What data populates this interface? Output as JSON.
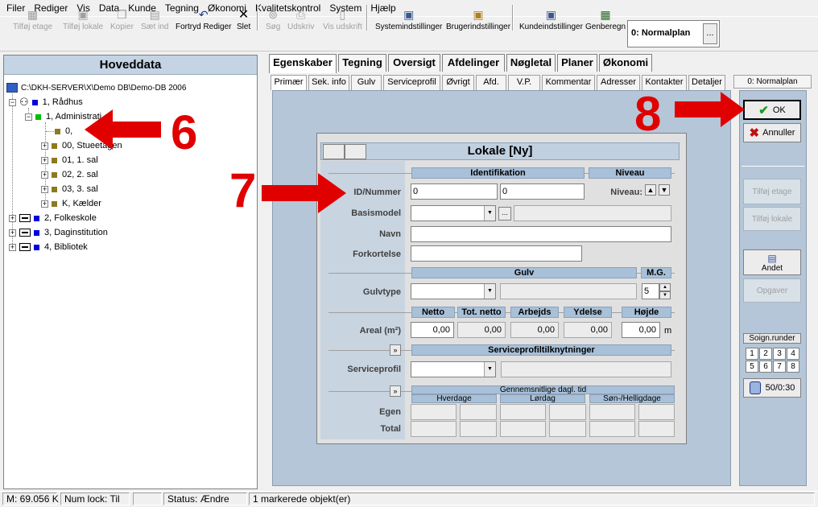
{
  "menu": [
    "Filer",
    "Rediger",
    "Vis",
    "Data",
    "Kunde",
    "Tegning",
    "Økonomi",
    "Kvalitetskontrol",
    "System",
    "Hjælp"
  ],
  "toolbar": {
    "tilfoj_etage": "Tilføj etage",
    "tilfoj_lokale": "Tilføj lokale",
    "kopier": "Kopier",
    "saet_ind": "Sæt ind",
    "fortryd": "Fortryd Rediger",
    "slet": "Slet",
    "sog": "Søg",
    "udskriv": "Udskriv",
    "vis_udskrift": "Vis udskrift",
    "systemindstillinger": "Systemindstillinger",
    "brugerindstillinger": "Brugerindstillinger",
    "kundeindstillinger": "Kundeindstillinger",
    "genberegn": "Genberegn",
    "plan": "0: Normalplan",
    "plan_btn": "..."
  },
  "left": {
    "title": "Hoveddata",
    "root": "C:\\DKH-SERVER\\X\\Demo DB\\Demo-DB 2006",
    "nodes": [
      "1, Rådhus",
      "1, Administrati",
      "0,",
      "00, Stueetagen",
      "01, 1. sal",
      "02, 2. sal",
      "03, 3. sal",
      "K, Kælder",
      "2, Folkeskole",
      "3, Daginstitution",
      "4, Bibliotek"
    ]
  },
  "tabs": [
    "Egenskaber",
    "Tegning",
    "Oversigt",
    "Afdelinger",
    "Nøgletal",
    "Planer",
    "Økonomi"
  ],
  "subtabs": [
    "Primær",
    "Sek. info",
    "Gulv",
    "Serviceprofil",
    "Øvrigt",
    "Afd.",
    "V.P.",
    "Kommentar",
    "Adresser",
    "Kontakter",
    "Detaljer"
  ],
  "dialog": {
    "title": "Lokale [Ny]",
    "identifikation": "Identifikation",
    "niveau_hdr": "Niveau",
    "id_label": "ID/Nummer",
    "id_val1": "0",
    "id_val2": "0",
    "niveau_label": "Niveau:",
    "basismodel": "Basismodel",
    "basis_btn": "...",
    "navn": "Navn",
    "forkortelse": "Forkortelse",
    "gulv_hdr": "Gulv",
    "mg_hdr": "M.G.",
    "gulvtype": "Gulvtype",
    "mg_val": "5",
    "netto": "Netto",
    "tot_netto": "Tot. netto",
    "arbejds": "Arbejds",
    "ydelse": "Ydelse",
    "hojde": "Højde",
    "areal": "Areal (m²)",
    "v_netto": "0,00",
    "v_tot": "0,00",
    "v_arb": "0,00",
    "v_yd": "0,00",
    "v_hojde": "0,00",
    "unit_m": "m",
    "expand": "»",
    "serviceprofil_hdr": "Serviceprofiltilknytninger",
    "serviceprofil": "Serviceprofil",
    "gennem": "Gennemsnitlige dagl. tid",
    "hverdage": "Hverdage",
    "lordag": "Lørdag",
    "son": "Søn-/Helligdage",
    "egen": "Egen",
    "total": "Total"
  },
  "right": {
    "plan": "0: Normalplan",
    "ok": "OK",
    "annuller": "Annuller",
    "tilfoj_etage": "Tilføj etage",
    "tilfoj_lokale": "Tilføj lokale",
    "andet": "Andet",
    "opgaver": "Opgaver",
    "soign": "Soign.runder",
    "grid": [
      "1",
      "2",
      "3",
      "4",
      "5",
      "6",
      "7",
      "8"
    ],
    "counter": "50/0:30"
  },
  "status": {
    "mem": "M: 69.056 K",
    "numlock": "Num lock: Til",
    "status": "Status: Ændre",
    "marked": "1 markerede objekt(er)"
  },
  "annotations": [
    "6",
    "7",
    "8"
  ],
  "colors": {
    "arrow": "#e00000",
    "panel": "#b4c6d8",
    "group": "#a8c0d8"
  }
}
